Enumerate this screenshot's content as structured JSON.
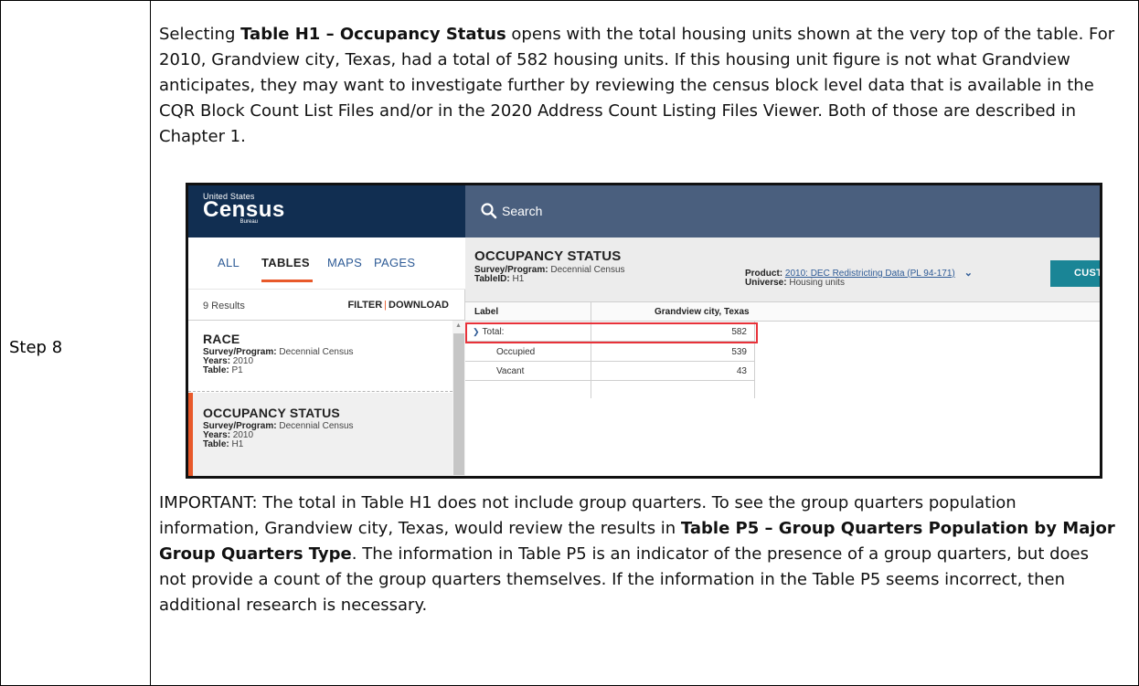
{
  "step_label": "Step 8",
  "intro": {
    "pre": "Selecting ",
    "bold": "Table H1 – Occupancy Status",
    "post1": " opens with the total housing units shown at the very top of the table. For 2010, Grandview city, Texas, had a total of 582 housing units. If this housing unit figure is not what Grandview anticipates, they may want to investigate further by reviewing the census block level data that is available in the CQR Block Count List Files and/or in the 2020 Address Count Listing Files Viewer. Both of those are described in Chapter 1."
  },
  "important": {
    "pre": "IMPORTANT: The total in Table H1 does not include group quarters. To see the group quarters population information, Grandview city, Texas, would review the results in ",
    "bold": "Table P5 – Group Quarters Population by Major Group Quarters Type",
    "post": ". The information in Table P5 is an indicator of the presence of a group quarters, but does not provide a count of the group quarters themselves. If the information in the Table P5 seems incorrect, then additional research is necessary."
  },
  "screenshot": {
    "logo": {
      "top": "United States",
      "main": "Census",
      "sub": "Bureau"
    },
    "search_label": "Search",
    "tabs": [
      "ALL",
      "TABLES",
      "MAPS",
      "PAGES"
    ],
    "results_count": "9 Results",
    "filter": "FILTER",
    "divider": "|",
    "download": "DOWNLOAD",
    "results": [
      {
        "title": "RACE",
        "program_key": "Survey/Program:",
        "program": " Decennial Census",
        "years_key": "Years:",
        "years": " 2010",
        "table_key": "Table:",
        "table": " P1"
      },
      {
        "title": "OCCUPANCY STATUS",
        "program_key": "Survey/Program:",
        "program": " Decennial Census",
        "years_key": "Years:",
        "years": " 2010",
        "table_key": "Table:",
        "table": " H1"
      }
    ],
    "header": {
      "title": "OCCUPANCY STATUS",
      "program_key": "Survey/Program:",
      "program": " Decennial Census",
      "tableid_key": "TableID:",
      "tableid": " H1",
      "product_key": "Product:",
      "product": "2010: DEC Redistricting Data (PL 94-171)",
      "universe_key": "Universe:",
      "universe": " Housing units",
      "customize_button": "CUSTO"
    },
    "grid": {
      "col_label": "Label",
      "col_geo": "Grandview city, Texas",
      "rows": [
        {
          "label": "Total:",
          "value": "582"
        },
        {
          "label": "Occupied",
          "value": "539"
        },
        {
          "label": "Vacant",
          "value": "43"
        }
      ]
    }
  }
}
